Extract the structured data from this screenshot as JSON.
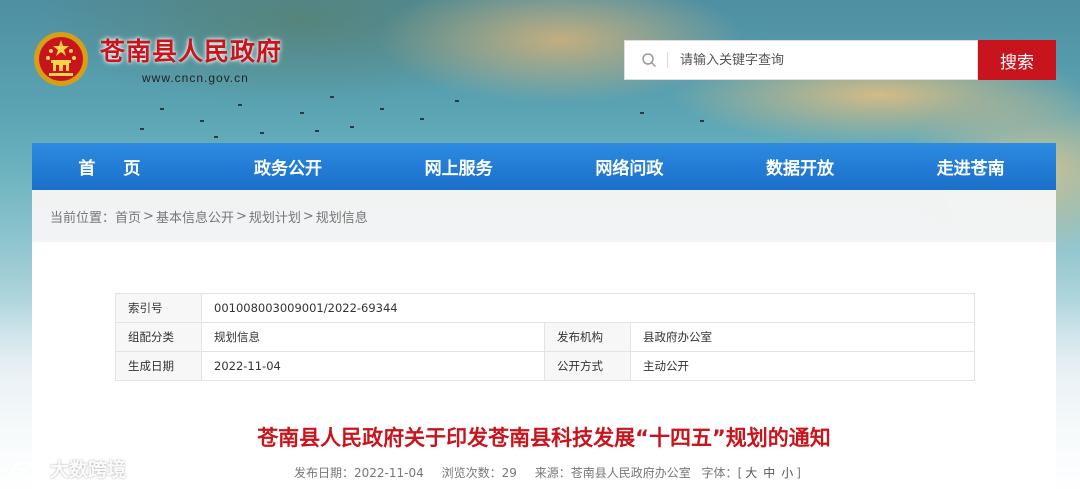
{
  "header": {
    "site_title": "苍南县人民政府",
    "site_url": "www.cncn.gov.cn",
    "logo_icon": "national-emblem-icon"
  },
  "search": {
    "placeholder": "请输入关键字查询",
    "button_label": "搜索"
  },
  "nav": {
    "items": [
      "首页",
      "政务公开",
      "网上服务",
      "网络问政",
      "数据开放",
      "走进苍南"
    ]
  },
  "breadcrumb": {
    "lead": "当前位置：",
    "items": [
      "首页",
      "基本信息公开",
      "规划计划",
      "规划信息"
    ],
    "separator": ">"
  },
  "meta": {
    "index_label": "索引号",
    "index_value": "001008003009001/2022-69344",
    "category_label": "组配分类",
    "category_value": "规划信息",
    "issuer_label": "发布机构",
    "issuer_value": "县政府办公室",
    "date_label": "生成日期",
    "date_value": "2022-11-04",
    "method_label": "公开方式",
    "method_value": "主动公开"
  },
  "document": {
    "title": "苍南县人民政府关于印发苍南县科技发展“十四五”规划的通知",
    "publish_date": "发布日期：2022-11-04",
    "views": "浏览次数：29",
    "source": "来源：苍南县人民政府办公室",
    "font_label": "字体：",
    "size_open": "[",
    "size_large": "大",
    "size_medium": "中",
    "size_small": "小",
    "size_close": "]"
  },
  "watermark": {
    "text": "大数跨境"
  },
  "colors": {
    "brand_red": "#c8151d",
    "nav_blue": "#1a6fc9"
  }
}
